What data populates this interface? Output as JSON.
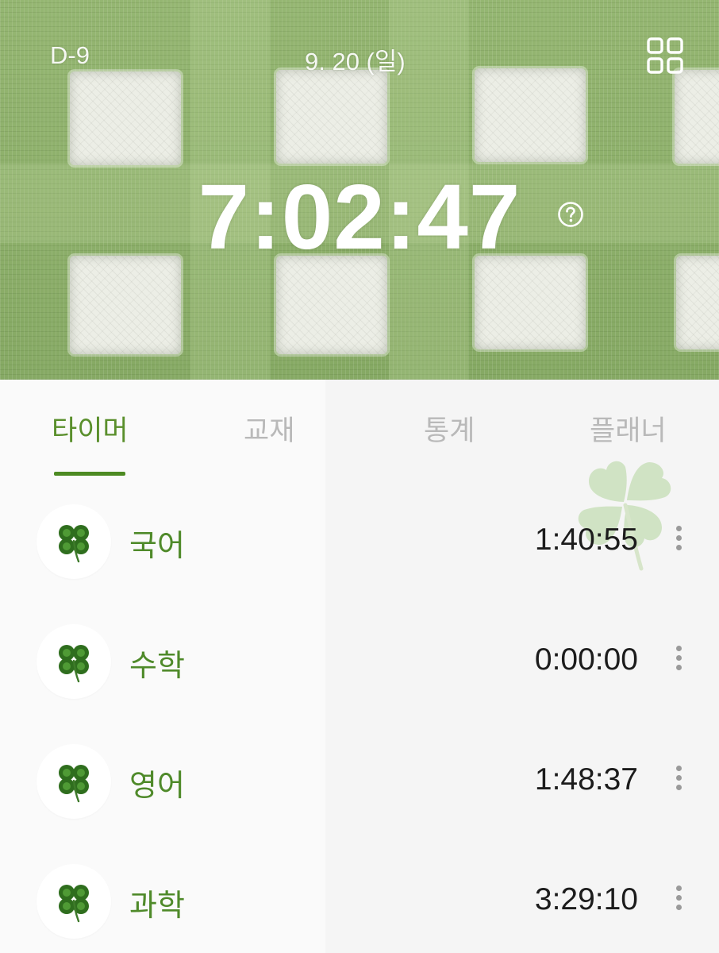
{
  "header": {
    "dday": "D-9",
    "date": "9. 20 (일)",
    "elapsed_time": "7:02:47",
    "grid_icon": "grid-icon",
    "help_icon": "help-circle-icon"
  },
  "tabs": [
    {
      "label": "타이머",
      "active": true
    },
    {
      "label": "교재",
      "active": false
    },
    {
      "label": "통계",
      "active": false
    },
    {
      "label": "플래너",
      "active": false
    }
  ],
  "colors": {
    "accent": "#4f8a2a",
    "header_green": "#8fb06c",
    "tab_inactive": "#b9b9b9"
  },
  "subjects": [
    {
      "name": "국어",
      "time": "1:40:55",
      "icon": "clover-icon"
    },
    {
      "name": "수학",
      "time": "0:00:00",
      "icon": "clover-icon"
    },
    {
      "name": "영어",
      "time": "1:48:37",
      "icon": "clover-icon"
    },
    {
      "name": "과학",
      "time": "3:29:10",
      "icon": "clover-icon"
    }
  ]
}
